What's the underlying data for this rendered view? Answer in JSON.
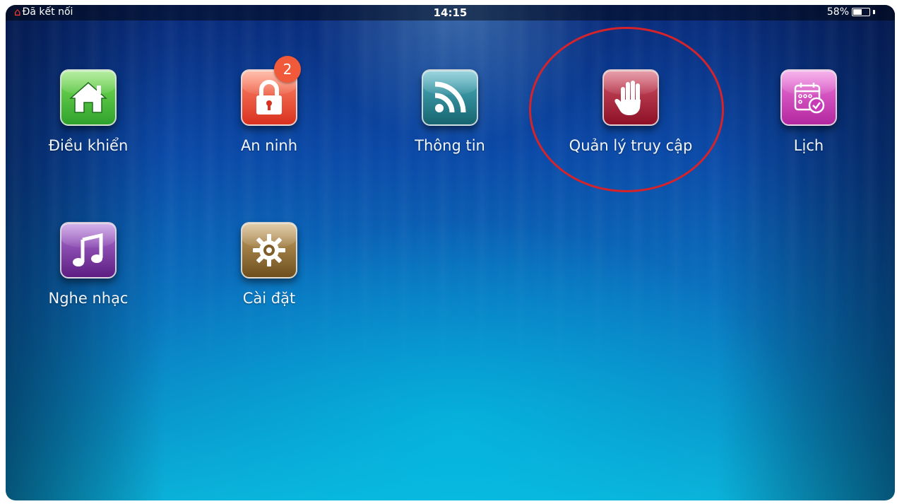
{
  "status_bar": {
    "connection_icon": "home-icon",
    "connection_label": "Đã kết nối",
    "time": "14:15",
    "battery_percent": "58%",
    "battery_level": 0.58
  },
  "apps": [
    {
      "label": "Điều khiển",
      "icon": "house-icon",
      "color": "#3cb83a"
    },
    {
      "label": "An ninh",
      "icon": "padlock-icon",
      "color": "#e2452d",
      "badge": "2"
    },
    {
      "label": "Thông tin",
      "icon": "rss-icon",
      "color": "#1f7d8e"
    },
    {
      "label": "Quản lý truy cập",
      "icon": "hand-icon",
      "color": "#a3172f"
    },
    {
      "label": "Lịch",
      "icon": "calendar-icon",
      "color": "#c63bb6"
    },
    {
      "label": "Nghe nhạc",
      "icon": "music-note-icon",
      "color": "#7b2e9d"
    },
    {
      "label": "Cài đặt",
      "icon": "gear-icon",
      "color": "#8a6a32"
    }
  ],
  "highlight_color": "#d5232b"
}
